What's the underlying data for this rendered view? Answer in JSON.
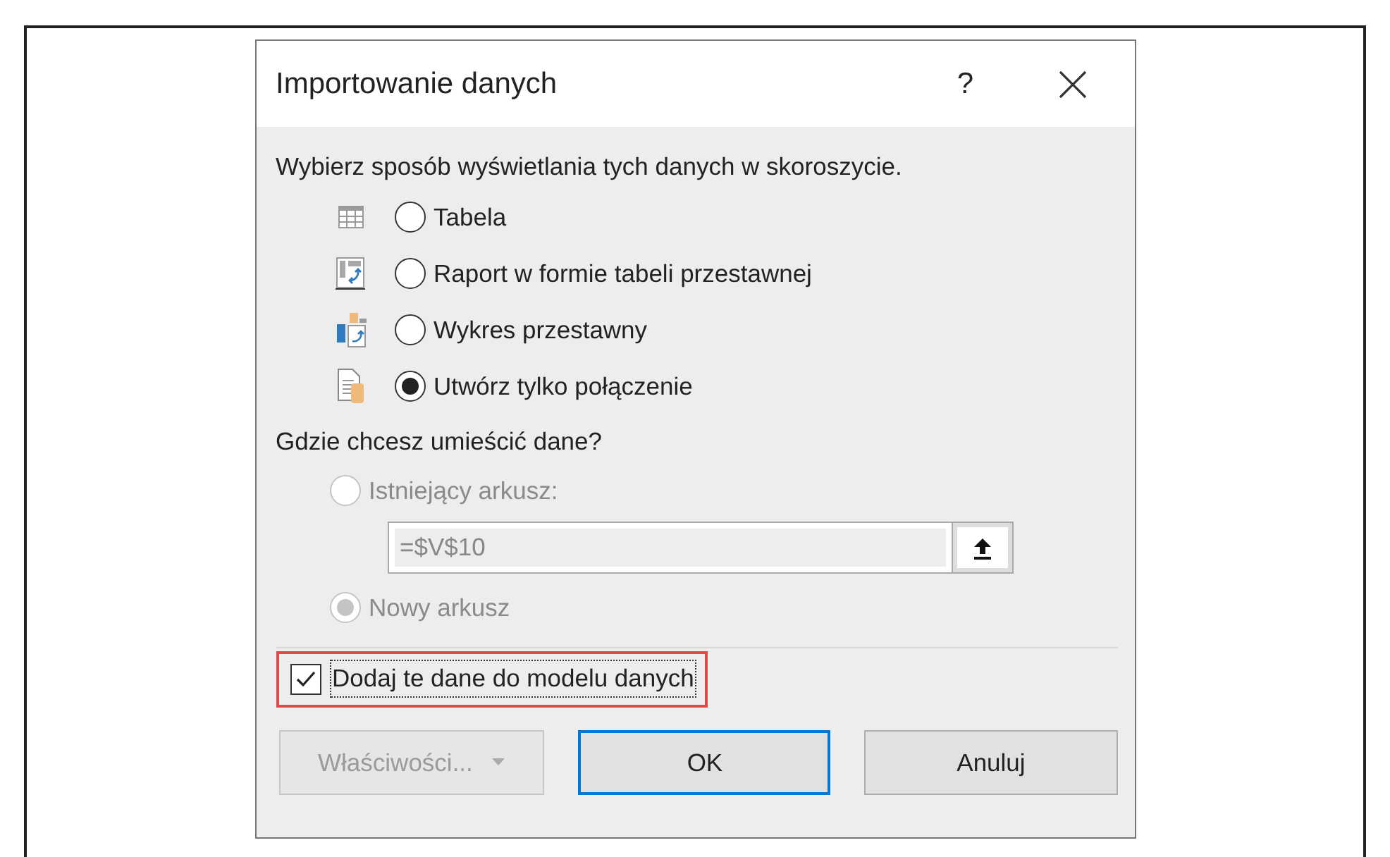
{
  "window": {
    "title": "Importowanie danych",
    "help": "?"
  },
  "display": {
    "prompt": "Wybierz sposób wyświetlania tych danych w skoroszycie.",
    "options": [
      {
        "kind": "table",
        "label": "Tabela",
        "selected": false
      },
      {
        "kind": "pivot-table",
        "label": "Raport w formie tabeli przestawnej",
        "selected": false
      },
      {
        "kind": "pivot-chart",
        "label": "Wykres przestawny",
        "selected": false
      },
      {
        "kind": "connection",
        "label": "Utwórz tylko połączenie",
        "selected": true
      }
    ]
  },
  "location": {
    "prompt": "Gdzie chcesz umieścić dane?",
    "options": [
      {
        "label": "Istniejący arkusz:",
        "selected": false,
        "disabled": true
      },
      {
        "label": "Nowy arkusz",
        "selected": true,
        "disabled": true
      }
    ],
    "range": {
      "value": "=$V$10",
      "disabled": true
    }
  },
  "data_model": {
    "label": "Dodaj te dane do modelu danych",
    "checked": true,
    "highlighted": true
  },
  "buttons": [
    {
      "label": "Właściwości...",
      "disabled": true,
      "default": false,
      "dropdown": true
    },
    {
      "label": "OK",
      "disabled": false,
      "default": true,
      "dropdown": false
    },
    {
      "label": "Anuluj",
      "disabled": false,
      "default": false,
      "dropdown": false
    }
  ]
}
